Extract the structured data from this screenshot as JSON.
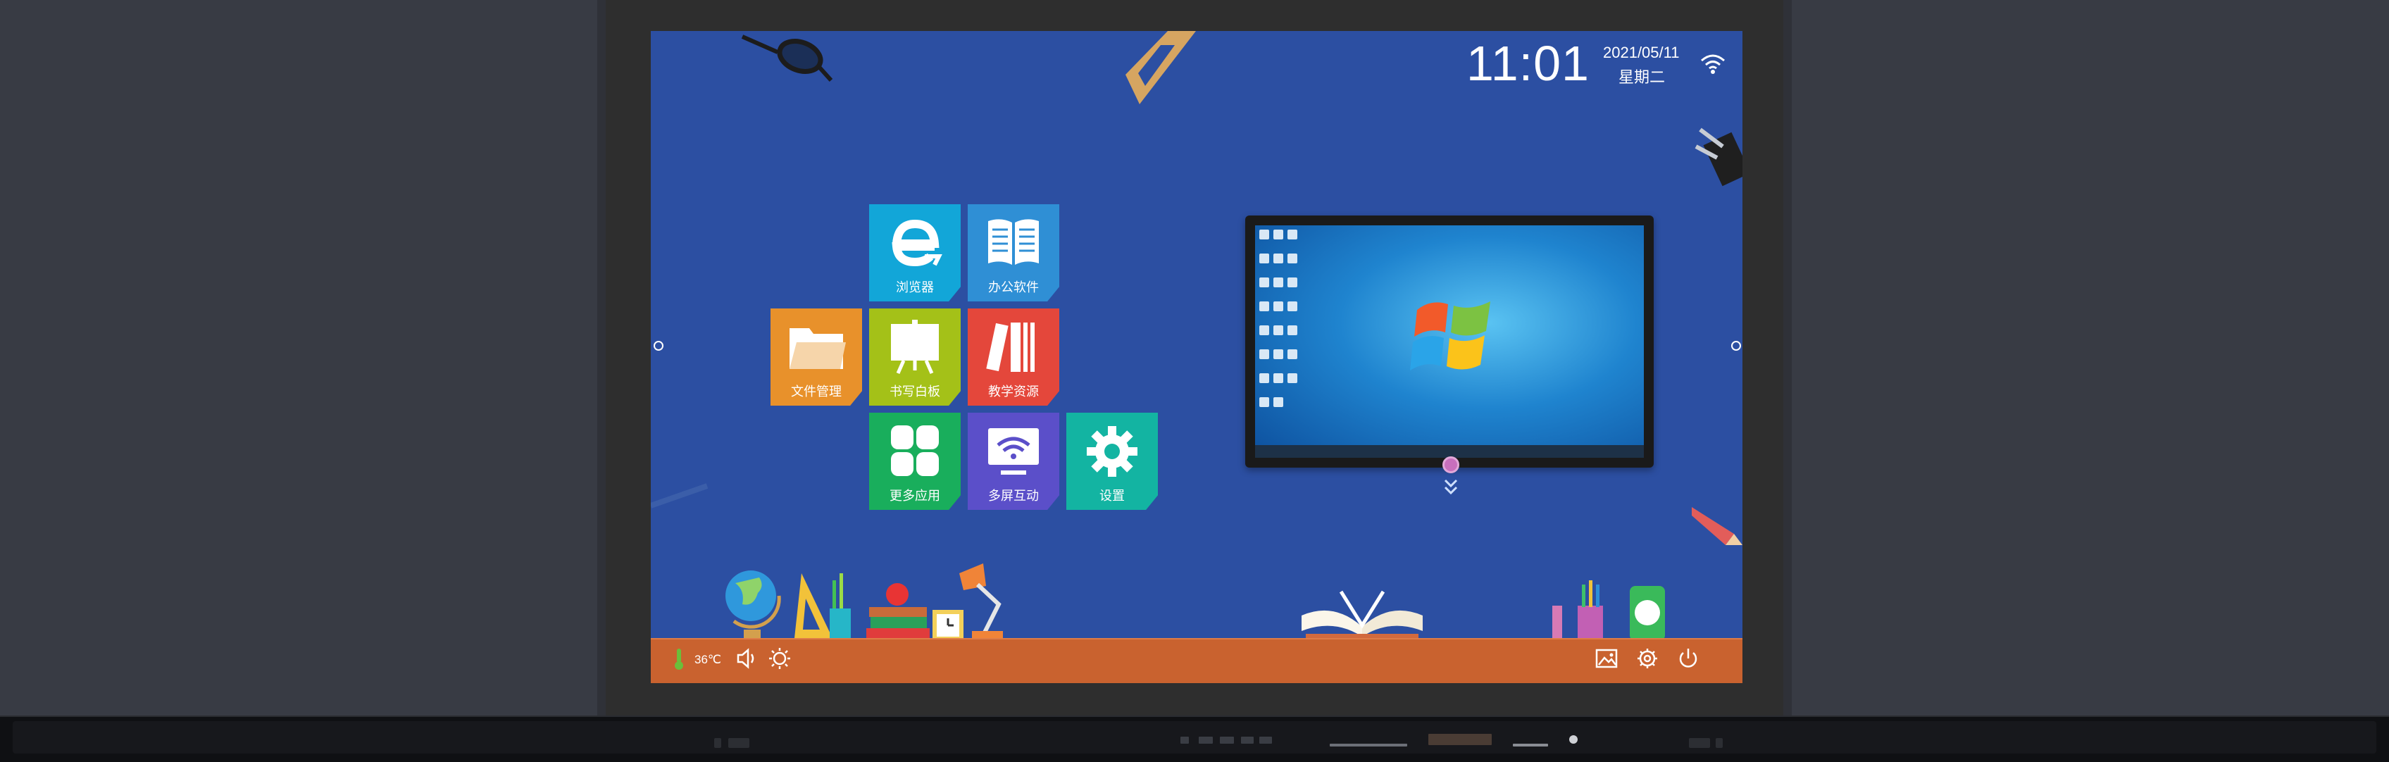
{
  "status": {
    "time": "11:01",
    "date": "2021/05/11",
    "weekday": "星期二",
    "temperature": "36℃"
  },
  "apps": [
    {
      "label": "浏览器",
      "icon": "browser-icon",
      "color": "#12a6d8"
    },
    {
      "label": "办公软件",
      "icon": "book-icon",
      "color": "#2f8fd5"
    },
    {
      "label": "文件管理",
      "icon": "folder-icon",
      "color": "#e8912b"
    },
    {
      "label": "书写白板",
      "icon": "whiteboard-icon",
      "color": "#a4c118"
    },
    {
      "label": "教学资源",
      "icon": "library-icon",
      "color": "#e4473b"
    },
    {
      "label": "更多应用",
      "icon": "apps-grid-icon",
      "color": "#19ae5c"
    },
    {
      "label": "多屏互动",
      "icon": "screen-cast-icon",
      "color": "#5b4fc9"
    },
    {
      "label": "设置",
      "icon": "gear-icon",
      "color": "#13b4a2"
    }
  ],
  "preview": {
    "desktop_label": "PC desktop preview",
    "color": "#1f84cf"
  },
  "bottom_bar_icons": [
    "wallpaper-icon",
    "settings-icon",
    "power-icon"
  ],
  "top_left_icons": [
    "thermometer-icon",
    "volume-icon",
    "brightness-icon"
  ]
}
